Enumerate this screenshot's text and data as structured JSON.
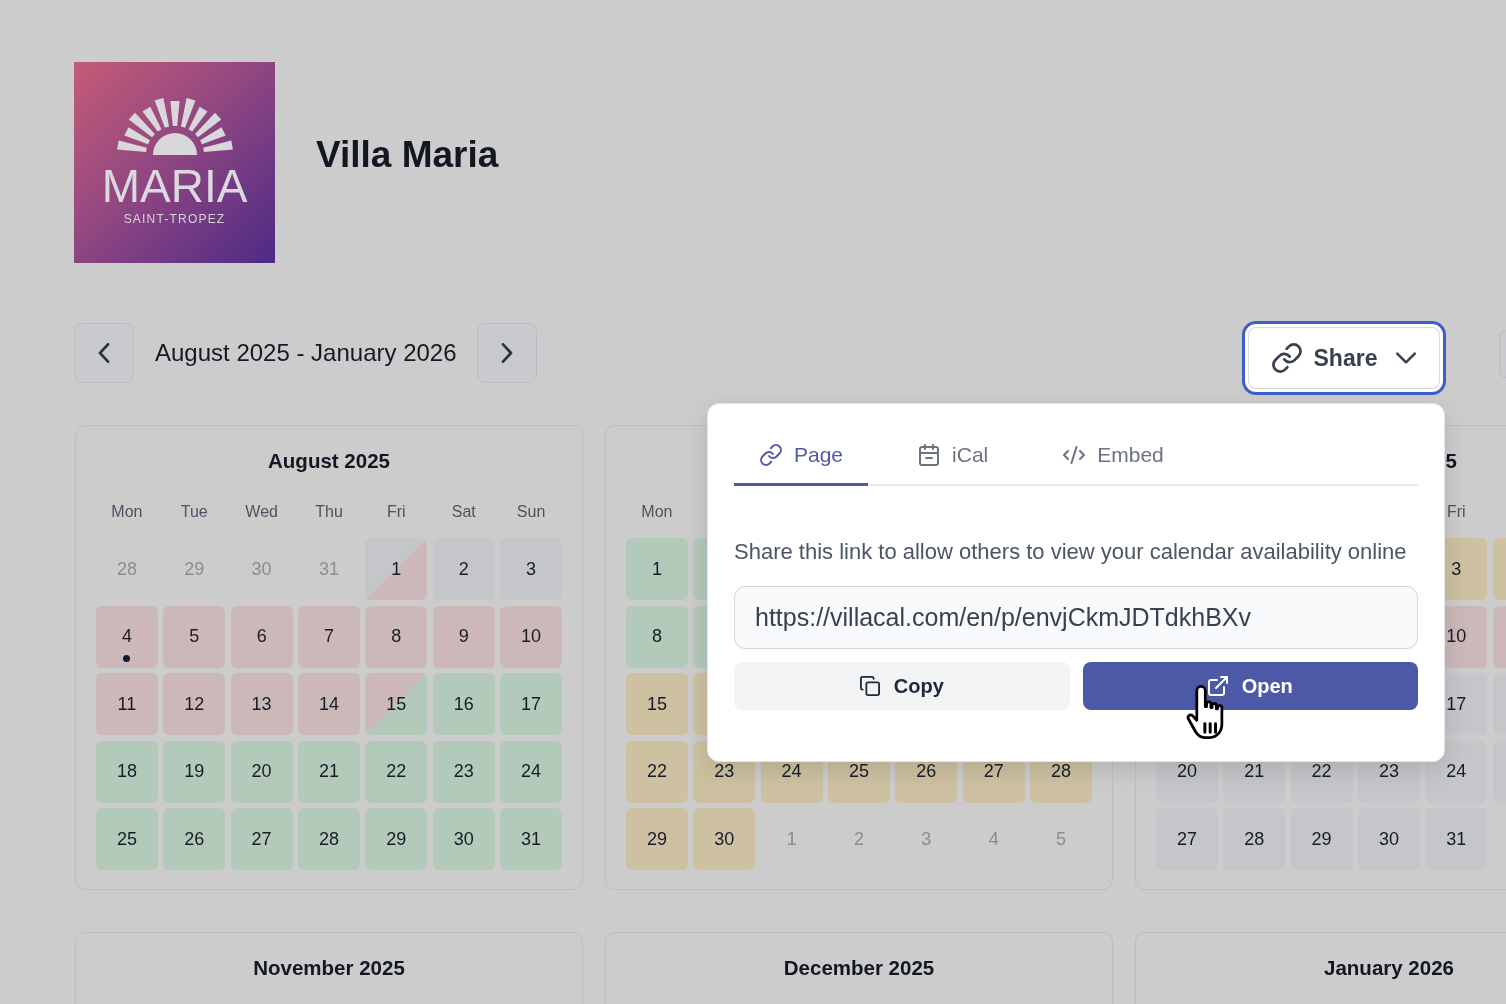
{
  "header": {
    "logo": {
      "wordmark": "MARIA",
      "tagline": "SAINT-TROPEZ"
    },
    "title": "Villa Maria"
  },
  "navigation": {
    "range": "August 2025 - January 2026"
  },
  "share_button": {
    "label": "Share",
    "expanded": true
  },
  "share_popover": {
    "tabs": [
      {
        "label": "Page",
        "kind": "page",
        "selected": true
      },
      {
        "label": "iCal",
        "kind": "ical",
        "selected": false
      },
      {
        "label": "Embed",
        "kind": "embed",
        "selected": false
      }
    ],
    "description": "Share this link to allow others to view your calendar availability online",
    "url_field": {
      "value": "https://villacal.com/en/p/envjCkmJDTdkhBXv"
    },
    "buttons": [
      {
        "label": "Copy",
        "kind": "copy"
      },
      {
        "label": "Open",
        "kind": "open"
      }
    ]
  },
  "months": [
    {
      "title": "August 2025",
      "weekdays": [
        {
          "kind": "label",
          "label": "Mon"
        },
        {
          "kind": "label",
          "label": "Tue"
        },
        {
          "kind": "label",
          "label": "Wed"
        },
        {
          "kind": "label",
          "label": "Thu"
        },
        {
          "kind": "label",
          "label": "Fri"
        },
        {
          "kind": "label",
          "label": "Sat"
        },
        {
          "kind": "label",
          "label": "Sun"
        }
      ],
      "weeks": [
        [
          {
            "kind": "outside",
            "day": "28",
            "today": false
          },
          {
            "kind": "outside",
            "day": "29",
            "today": false
          },
          {
            "kind": "outside",
            "day": "30",
            "today": false
          },
          {
            "kind": "outside",
            "day": "31",
            "today": false
          },
          {
            "kind": "day",
            "day": "1",
            "color": "#c5c6c9",
            "split": {
              "color": "#cdb8b9"
            },
            "today": false
          },
          {
            "kind": "day",
            "day": "2",
            "color": "#c5c6c9",
            "today": false
          },
          {
            "kind": "day",
            "day": "3",
            "color": "#c5c6c9",
            "today": false
          }
        ],
        [
          {
            "kind": "day",
            "day": "4",
            "color": "#cdb8b9",
            "today": true
          },
          {
            "kind": "day",
            "day": "5",
            "color": "#cdb8b9",
            "today": false
          },
          {
            "kind": "day",
            "day": "6",
            "color": "#cdb8b9",
            "today": false
          },
          {
            "kind": "day",
            "day": "7",
            "color": "#cdb8b9",
            "today": false
          },
          {
            "kind": "day",
            "day": "8",
            "color": "#cdb8b9",
            "today": false
          },
          {
            "kind": "day",
            "day": "9",
            "color": "#cdb8b9",
            "today": false
          },
          {
            "kind": "day",
            "day": "10",
            "color": "#cdb8b9",
            "today": false
          }
        ],
        [
          {
            "kind": "day",
            "day": "11",
            "color": "#cdb8b9",
            "today": false
          },
          {
            "kind": "day",
            "day": "12",
            "color": "#cdb8b9",
            "today": false
          },
          {
            "kind": "day",
            "day": "13",
            "color": "#cdb8b9",
            "today": false
          },
          {
            "kind": "day",
            "day": "14",
            "color": "#cdb8b9",
            "today": false
          },
          {
            "kind": "day",
            "day": "15",
            "color": "#cdb8b9",
            "split": {
              "color": "#b3c9b9"
            },
            "today": false
          },
          {
            "kind": "day",
            "day": "16",
            "color": "#b3c9b9",
            "today": false
          },
          {
            "kind": "day",
            "day": "17",
            "color": "#b3c9b9",
            "today": false
          }
        ],
        [
          {
            "kind": "day",
            "day": "18",
            "color": "#b3c9b9",
            "today": false
          },
          {
            "kind": "day",
            "day": "19",
            "color": "#b3c9b9",
            "today": false
          },
          {
            "kind": "day",
            "day": "20",
            "color": "#b3c9b9",
            "today": false
          },
          {
            "kind": "day",
            "day": "21",
            "color": "#b3c9b9",
            "today": false
          },
          {
            "kind": "day",
            "day": "22",
            "color": "#b3c9b9",
            "today": false
          },
          {
            "kind": "day",
            "day": "23",
            "color": "#b3c9b9",
            "today": false
          },
          {
            "kind": "day",
            "day": "24",
            "color": "#b3c9b9",
            "today": false
          }
        ],
        [
          {
            "kind": "day",
            "day": "25",
            "color": "#b3c9b9",
            "today": false
          },
          {
            "kind": "day",
            "day": "26",
            "color": "#b3c9b9",
            "today": false
          },
          {
            "kind": "day",
            "day": "27",
            "color": "#b3c9b9",
            "today": false
          },
          {
            "kind": "day",
            "day": "28",
            "color": "#b3c9b9",
            "today": false
          },
          {
            "kind": "day",
            "day": "29",
            "color": "#b3c9b9",
            "today": false
          },
          {
            "kind": "day",
            "day": "30",
            "color": "#b3c9b9",
            "today": false
          },
          {
            "kind": "day",
            "day": "31",
            "color": "#b3c9b9",
            "today": false
          }
        ]
      ]
    },
    {
      "weekdays": [
        {
          "kind": "label",
          "label": "Mon"
        }
      ],
      "weeks": [
        [
          {
            "kind": "day",
            "day": "1",
            "color": "#b3c9b9",
            "today": false
          },
          {
            "kind": "day",
            "color": "#b3c9b9",
            "today": false
          }
        ],
        [
          {
            "kind": "day",
            "day": "8",
            "color": "#b3c9b9",
            "today": false
          },
          {
            "kind": "day",
            "color": "#b3c9b9",
            "today": false
          }
        ],
        [
          {
            "kind": "day",
            "day": "15",
            "color": "#cdc1a1",
            "today": false
          },
          {
            "kind": "day",
            "color": "#cdc1a1",
            "today": false
          }
        ],
        [
          {
            "kind": "day",
            "day": "22",
            "color": "#cdc1a1",
            "today": false
          },
          {
            "kind": "day",
            "day": "23",
            "color": "#cdc1a1",
            "today": false
          },
          {
            "kind": "day",
            "day": "24",
            "color": "#cdc1a1",
            "today": false
          },
          {
            "kind": "day",
            "day": "25",
            "color": "#cdc1a1",
            "today": false
          },
          {
            "kind": "day",
            "day": "26",
            "color": "#cdc1a1",
            "today": false
          },
          {
            "kind": "day",
            "day": "27",
            "color": "#cdc1a1",
            "today": false
          },
          {
            "kind": "day",
            "day": "28",
            "color": "#cdc1a1",
            "today": false
          }
        ],
        [
          {
            "kind": "day",
            "day": "29",
            "color": "#cdc1a1",
            "today": false
          },
          {
            "kind": "day",
            "day": "30",
            "color": "#cdc1a1",
            "today": false
          },
          {
            "kind": "outside",
            "day": "1",
            "today": false
          },
          {
            "kind": "outside",
            "day": "2",
            "today": false
          },
          {
            "kind": "outside",
            "day": "3",
            "today": false
          },
          {
            "kind": "outside",
            "day": "4",
            "today": false
          },
          {
            "kind": "outside",
            "day": "5",
            "today": false
          }
        ]
      ]
    },
    {
      "title": "5",
      "title_clipped": true,
      "weekdays": [
        {
          "kind": "covered"
        },
        {
          "kind": "covered"
        },
        {
          "kind": "covered"
        },
        {
          "kind": "covered"
        },
        {
          "kind": "label",
          "label": "Fri"
        }
      ],
      "weeks": [
        [
          {
            "kind": "covered"
          },
          {
            "kind": "covered"
          },
          {
            "kind": "covered"
          },
          {
            "kind": "covered"
          },
          {
            "kind": "day",
            "day": "3",
            "color": "#cdc1a1",
            "today": false
          },
          {
            "kind": "day",
            "color": "#cdc1a1",
            "today": false
          }
        ],
        [
          {
            "kind": "covered"
          },
          {
            "kind": "covered"
          },
          {
            "kind": "covered"
          },
          {
            "kind": "covered"
          },
          {
            "kind": "day",
            "day": "10",
            "color": "#cdb8b9",
            "today": false
          },
          {
            "kind": "day",
            "color": "#cdb8b9",
            "today": false
          }
        ],
        [
          {
            "kind": "covered"
          },
          {
            "kind": "covered"
          },
          {
            "kind": "covered"
          },
          {
            "kind": "covered"
          },
          {
            "kind": "day",
            "day": "17",
            "color": "#c5c6c9",
            "today": false
          },
          {
            "kind": "day",
            "color": "#c5c6c9",
            "today": false
          }
        ],
        [
          {
            "kind": "day",
            "day": "20",
            "color": "#c5c6c9",
            "today": false
          },
          {
            "kind": "day",
            "day": "21",
            "color": "#c5c6c9",
            "today": false
          },
          {
            "kind": "day",
            "day": "22",
            "color": "#c5c6c9",
            "today": false
          },
          {
            "kind": "day",
            "day": "23",
            "color": "#c5c6c9",
            "today": false
          },
          {
            "kind": "day",
            "day": "24",
            "color": "#c5c6c9",
            "today": false
          },
          {
            "kind": "day",
            "color": "#c5c6c9",
            "today": false
          }
        ],
        [
          {
            "kind": "day",
            "day": "27",
            "color": "#c5c6c9",
            "today": false
          },
          {
            "kind": "day",
            "day": "28",
            "color": "#c5c6c9",
            "today": false
          },
          {
            "kind": "day",
            "day": "29",
            "color": "#c5c6c9",
            "today": false
          },
          {
            "kind": "day",
            "day": "30",
            "color": "#c5c6c9",
            "today": false
          },
          {
            "kind": "day",
            "day": "31",
            "color": "#c5c6c9",
            "today": false
          }
        ]
      ]
    },
    {
      "title": "November 2025"
    },
    {
      "title": "December 2025"
    },
    {
      "title": "January 2026"
    }
  ]
}
